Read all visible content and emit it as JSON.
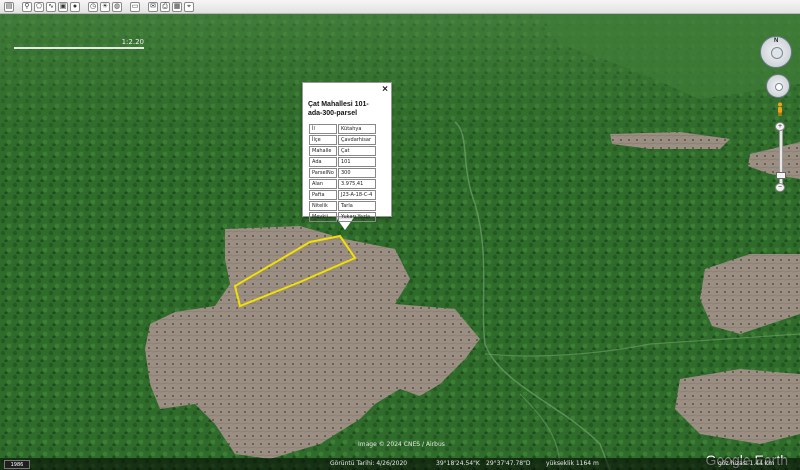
{
  "toolbar": {
    "buttons": [
      "sidebar-toggle-icon",
      "placemark-icon",
      "polygon-icon",
      "path-icon",
      "image-overlay-icon",
      "record-tour-icon",
      "historical-imagery-icon",
      "sun-icon",
      "planets-icon",
      "ruler-icon",
      "email-icon",
      "print-icon",
      "save-image-icon",
      "maps-icon"
    ]
  },
  "map": {
    "scale_label": "1:2.20"
  },
  "popup": {
    "title": "Çat Mahallesi 101-ada-300-parsel",
    "close": "×",
    "rows": [
      {
        "key": "İl",
        "value": "Kütahya"
      },
      {
        "key": "İlçe",
        "value": "Çavdarhisar"
      },
      {
        "key": "Mahalle",
        "value": "Çat"
      },
      {
        "key": "Ada",
        "value": "101"
      },
      {
        "key": "ParselNo",
        "value": "300"
      },
      {
        "key": "Alan",
        "value": "3.975,41"
      },
      {
        "key": "Pafta",
        "value": "J23-A-18-C-4"
      },
      {
        "key": "Nitelik",
        "value": "Tarla"
      },
      {
        "key": "Mevkii",
        "value": "Yukarı Yazla"
      }
    ]
  },
  "attribution": "Image © 2024 CNES / Airbus",
  "logo": "Google Earth",
  "status": {
    "year": "1986",
    "date": "Görüntü Tarihi: 4/26/2020",
    "lat": "39°18'24.54\"K",
    "lon": "29°37'47.78\"D",
    "elevation": "yükseklik  1164 m",
    "eye_alt": "göz hizası   1.44 km"
  },
  "colors": {
    "parcel_outline": "#f2e000",
    "forest": "#2f6b2a",
    "field": "#9b8f80"
  }
}
